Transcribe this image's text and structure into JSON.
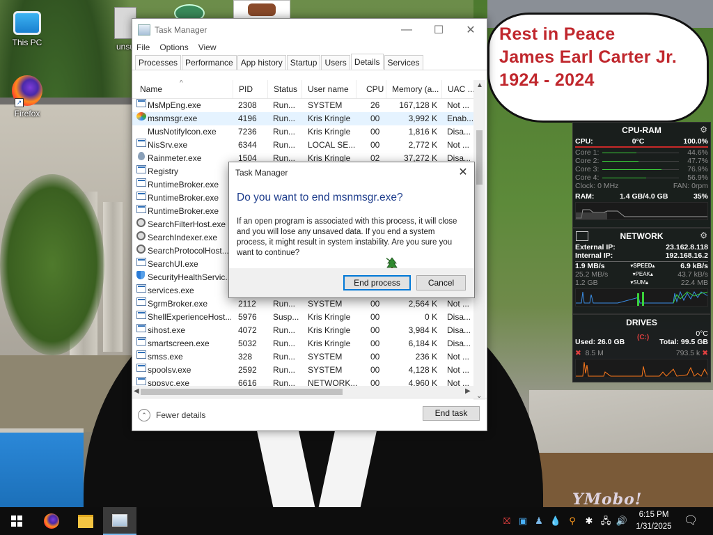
{
  "desktop": {
    "icons": [
      {
        "label": "This PC"
      },
      {
        "label": "Firefox"
      },
      {
        "label": "unsu"
      }
    ],
    "memorial": {
      "line1": "Rest in Peace",
      "line2": "James Earl Carter Jr.",
      "line3": "1924 - 2024"
    },
    "watermark": "YMobo!"
  },
  "gadgets": {
    "cpu": {
      "title": "CPU-RAM",
      "cpu_label": "CPU:",
      "cpu_temp": "0°C",
      "cpu_pct": "100.0%",
      "cores": [
        {
          "label": "Core 1:",
          "value": "44.6%",
          "level": 0.446
        },
        {
          "label": "Core 2:",
          "value": "47.7%",
          "level": 0.477
        },
        {
          "label": "Core 3:",
          "value": "76.9%",
          "level": 0.769
        },
        {
          "label": "Core 4:",
          "value": "56.9%",
          "level": 0.569
        }
      ],
      "clock": "Clock: 0 MHz",
      "fan": "FAN: 0rpm",
      "ram_label": "RAM:",
      "ram_value": "1.4 GB/4.0 GB",
      "ram_pct": "35%"
    },
    "network": {
      "title": "NETWORK",
      "external_label": "External IP:",
      "external_ip": "23.162.8.118",
      "internal_label": "Internal IP:",
      "internal_ip": "192.168.16.2",
      "speed_left": "1.9 MB/s",
      "speed_label": "SPEED",
      "speed_right": "6.9 kB/s",
      "peak_left": "25.2 MB/s",
      "peak_label": "PEAK",
      "peak_right": "43.7 kB/s",
      "sum_left": "1.2 GB",
      "sum_label": "SUM",
      "sum_right": "22.4 MB"
    },
    "drives": {
      "title": "DRIVES",
      "temp": "0°C",
      "drive": "(C:)",
      "used": "Used: 26.0 GB",
      "total": "Total: 99.5 GB",
      "read": "8.5 M",
      "write": "793.5 k"
    }
  },
  "taskmanager": {
    "title": "Task Manager",
    "menu": [
      "File",
      "Options",
      "View"
    ],
    "tabs": [
      "Processes",
      "Performance",
      "App history",
      "Startup",
      "Users",
      "Details",
      "Services"
    ],
    "active_tab": "Details",
    "columns": [
      "Name",
      "PID",
      "Status",
      "User name",
      "CPU",
      "Memory (a...",
      "UAC ..."
    ],
    "rows": [
      {
        "name": "MsMpEng.exe",
        "pid": "2308",
        "status": "Run...",
        "user": "SYSTEM",
        "cpu": "26",
        "mem": "167,128 K",
        "uac": "Not ..."
      },
      {
        "name": "msnmsgr.exe",
        "pid": "4196",
        "status": "Run...",
        "user": "Kris Kringle",
        "cpu": "00",
        "mem": "3,992 K",
        "uac": "Enab..."
      },
      {
        "name": "MusNotifyIcon.exe",
        "pid": "7236",
        "status": "Run...",
        "user": "Kris Kringle",
        "cpu": "00",
        "mem": "1,816 K",
        "uac": "Disa..."
      },
      {
        "name": "NisSrv.exe",
        "pid": "6344",
        "status": "Run...",
        "user": "LOCAL SE...",
        "cpu": "00",
        "mem": "2,772 K",
        "uac": "Not ..."
      },
      {
        "name": "Rainmeter.exe",
        "pid": "1504",
        "status": "Run...",
        "user": "Kris Kringle",
        "cpu": "02",
        "mem": "37,272 K",
        "uac": "Disa..."
      },
      {
        "name": "Registry",
        "pid": "",
        "status": "",
        "user": "",
        "cpu": "",
        "mem": "",
        "uac": ""
      },
      {
        "name": "RuntimeBroker.exe",
        "pid": "",
        "status": "",
        "user": "",
        "cpu": "",
        "mem": "",
        "uac": ""
      },
      {
        "name": "RuntimeBroker.exe",
        "pid": "",
        "status": "",
        "user": "",
        "cpu": "",
        "mem": "",
        "uac": ""
      },
      {
        "name": "RuntimeBroker.exe",
        "pid": "",
        "status": "",
        "user": "",
        "cpu": "",
        "mem": "",
        "uac": ""
      },
      {
        "name": "SearchFilterHost.exe",
        "pid": "",
        "status": "",
        "user": "",
        "cpu": "",
        "mem": "",
        "uac": ""
      },
      {
        "name": "SearchIndexer.exe",
        "pid": "",
        "status": "",
        "user": "",
        "cpu": "",
        "mem": "",
        "uac": ""
      },
      {
        "name": "SearchProtocolHost....",
        "pid": "",
        "status": "",
        "user": "",
        "cpu": "",
        "mem": "",
        "uac": ""
      },
      {
        "name": "SearchUI.exe",
        "pid": "",
        "status": "",
        "user": "",
        "cpu": "",
        "mem": "",
        "uac": ""
      },
      {
        "name": "SecurityHealthServic...",
        "pid": "",
        "status": "",
        "user": "",
        "cpu": "",
        "mem": "",
        "uac": ""
      },
      {
        "name": "services.exe",
        "pid": "",
        "status": "",
        "user": "",
        "cpu": "",
        "mem": "",
        "uac": ""
      },
      {
        "name": "SgrmBroker.exe",
        "pid": "2112",
        "status": "Run...",
        "user": "SYSTEM",
        "cpu": "00",
        "mem": "2,564 K",
        "uac": "Not ..."
      },
      {
        "name": "ShellExperienceHost....",
        "pid": "5976",
        "status": "Susp...",
        "user": "Kris Kringle",
        "cpu": "00",
        "mem": "0 K",
        "uac": "Disa..."
      },
      {
        "name": "sihost.exe",
        "pid": "4072",
        "status": "Run...",
        "user": "Kris Kringle",
        "cpu": "00",
        "mem": "3,984 K",
        "uac": "Disa..."
      },
      {
        "name": "smartscreen.exe",
        "pid": "5032",
        "status": "Run...",
        "user": "Kris Kringle",
        "cpu": "00",
        "mem": "6,184 K",
        "uac": "Disa..."
      },
      {
        "name": "smss.exe",
        "pid": "328",
        "status": "Run...",
        "user": "SYSTEM",
        "cpu": "00",
        "mem": "236 K",
        "uac": "Not ..."
      },
      {
        "name": "spoolsv.exe",
        "pid": "2592",
        "status": "Run...",
        "user": "SYSTEM",
        "cpu": "00",
        "mem": "4,128 K",
        "uac": "Not ..."
      },
      {
        "name": "sppsvc.exe",
        "pid": "6616",
        "status": "Run...",
        "user": "NETWORK...",
        "cpu": "00",
        "mem": "4,960 K",
        "uac": "Not ..."
      }
    ],
    "fewer_details": "Fewer details",
    "end_task": "End task"
  },
  "dialog": {
    "title": "Task Manager",
    "question": "Do you want to end msnmsgr.exe?",
    "message": "If an open program is associated with this process, it will close and you will lose any unsaved data. If you end a system process, it might result in system instability. Are you sure you want to continue?",
    "end_process": "End process",
    "cancel": "Cancel"
  },
  "taskbar": {
    "time": "6:15 PM",
    "date": "1/31/2025"
  }
}
